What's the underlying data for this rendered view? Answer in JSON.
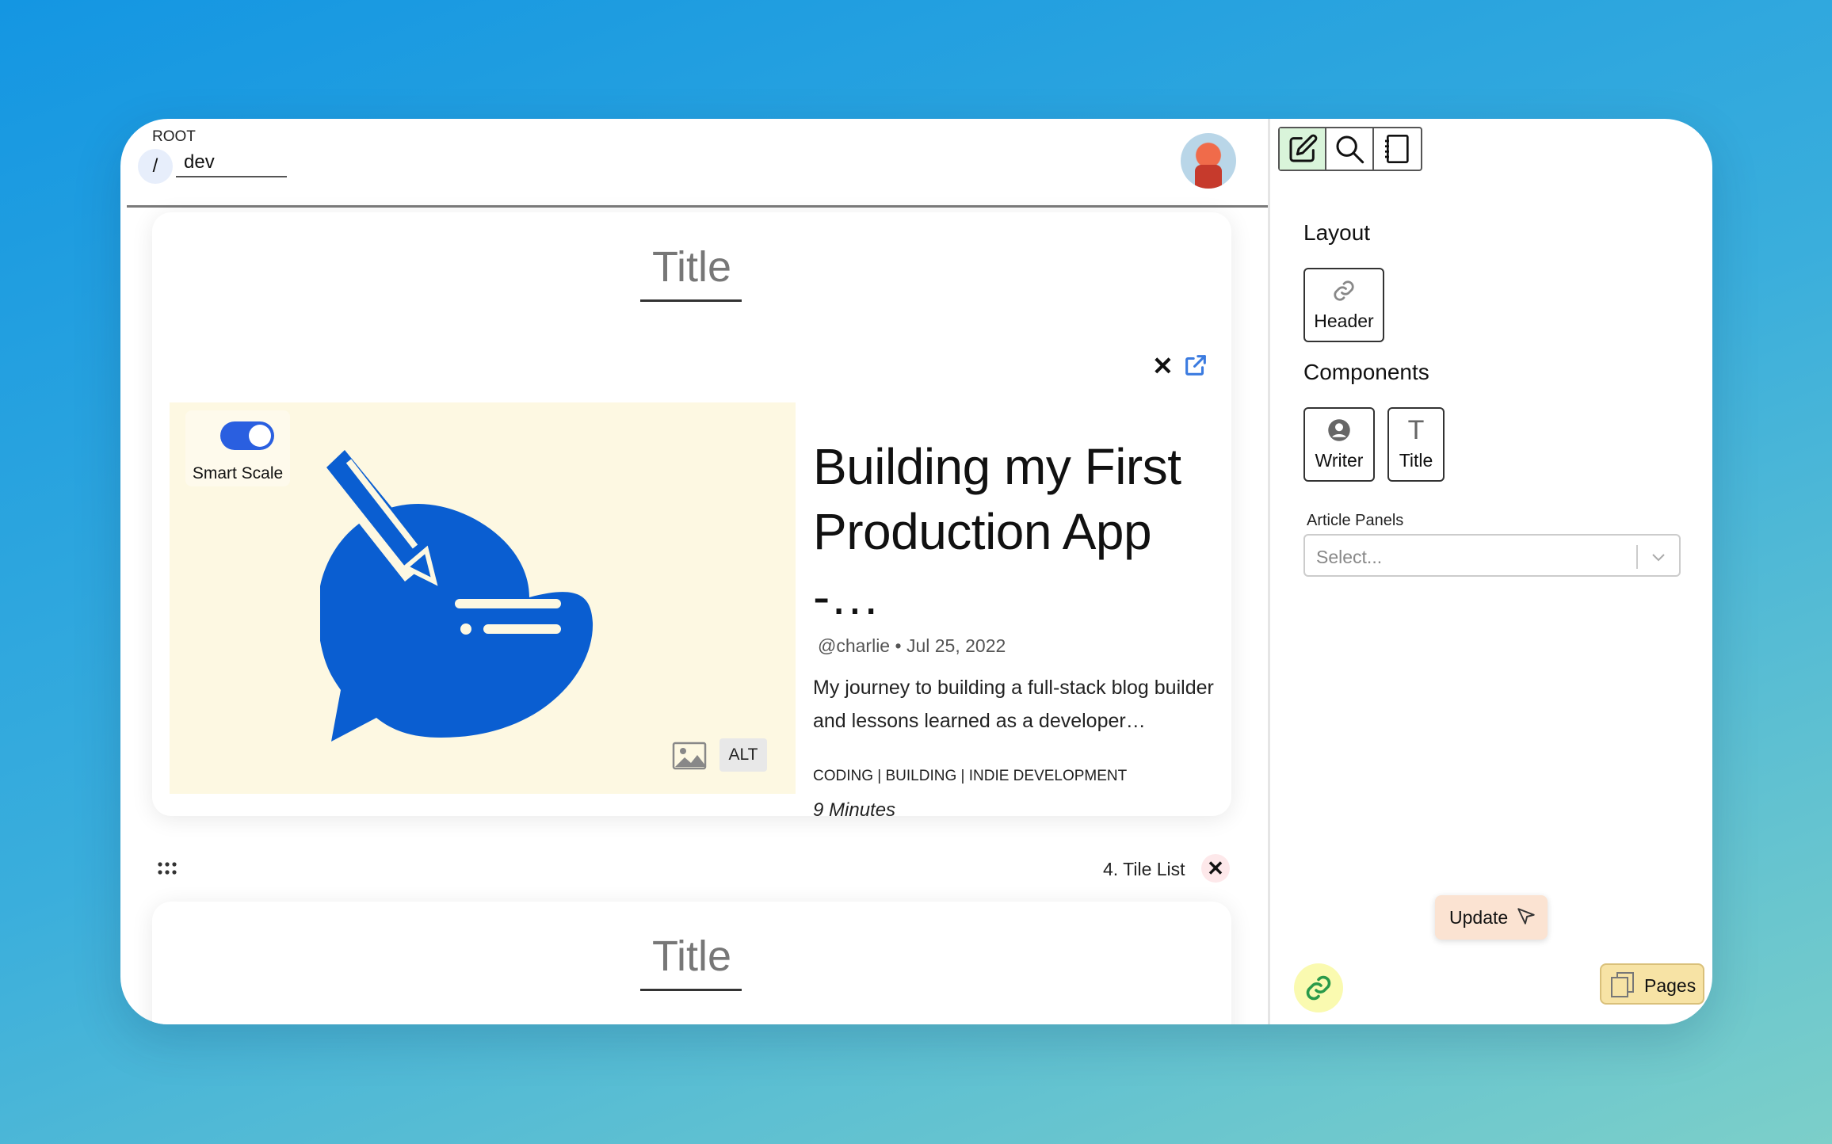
{
  "header": {
    "root_label": "ROOT",
    "root_separator": "/",
    "path_value": "dev"
  },
  "card": {
    "title": "Title",
    "close_glyph": "✕",
    "hero": {
      "smart_scale_label": "Smart Scale",
      "smart_scale_on": true,
      "alt_label": "ALT",
      "art_color": "#0a5ed1"
    },
    "article": {
      "title": "Building my First Production App -…",
      "author": "@charlie",
      "meta_sep": "•",
      "date": "Jul 25, 2022",
      "description": "My journey to building a full-stack blog builder and lessons learned as a developer…",
      "tags": "CODING | BUILDING | INDIE DEVELOPMENT",
      "read_time": "9 Minutes"
    }
  },
  "tile_list": {
    "label": "4. Tile List",
    "close_glyph": "✕",
    "next_title": "Title"
  },
  "sidebar": {
    "layout_heading": "Layout",
    "layout_items": [
      {
        "label": "Header",
        "icon": "link-icon"
      }
    ],
    "components_heading": "Components",
    "component_items": [
      {
        "label": "Writer",
        "icon": "user-icon"
      },
      {
        "label": "Title",
        "icon": "text-t-icon",
        "glyph": "T"
      }
    ],
    "panels_label": "Article Panels",
    "panels_placeholder": "Select...",
    "update_label": "Update",
    "pages_label": "Pages"
  },
  "colors": {
    "accent_blue": "#2a5fe0",
    "active_tab": "#d9f4da",
    "update_bg": "#fbe3d2",
    "pages_bg": "#f7e3a5",
    "link_fab_bg": "#fafab0"
  }
}
